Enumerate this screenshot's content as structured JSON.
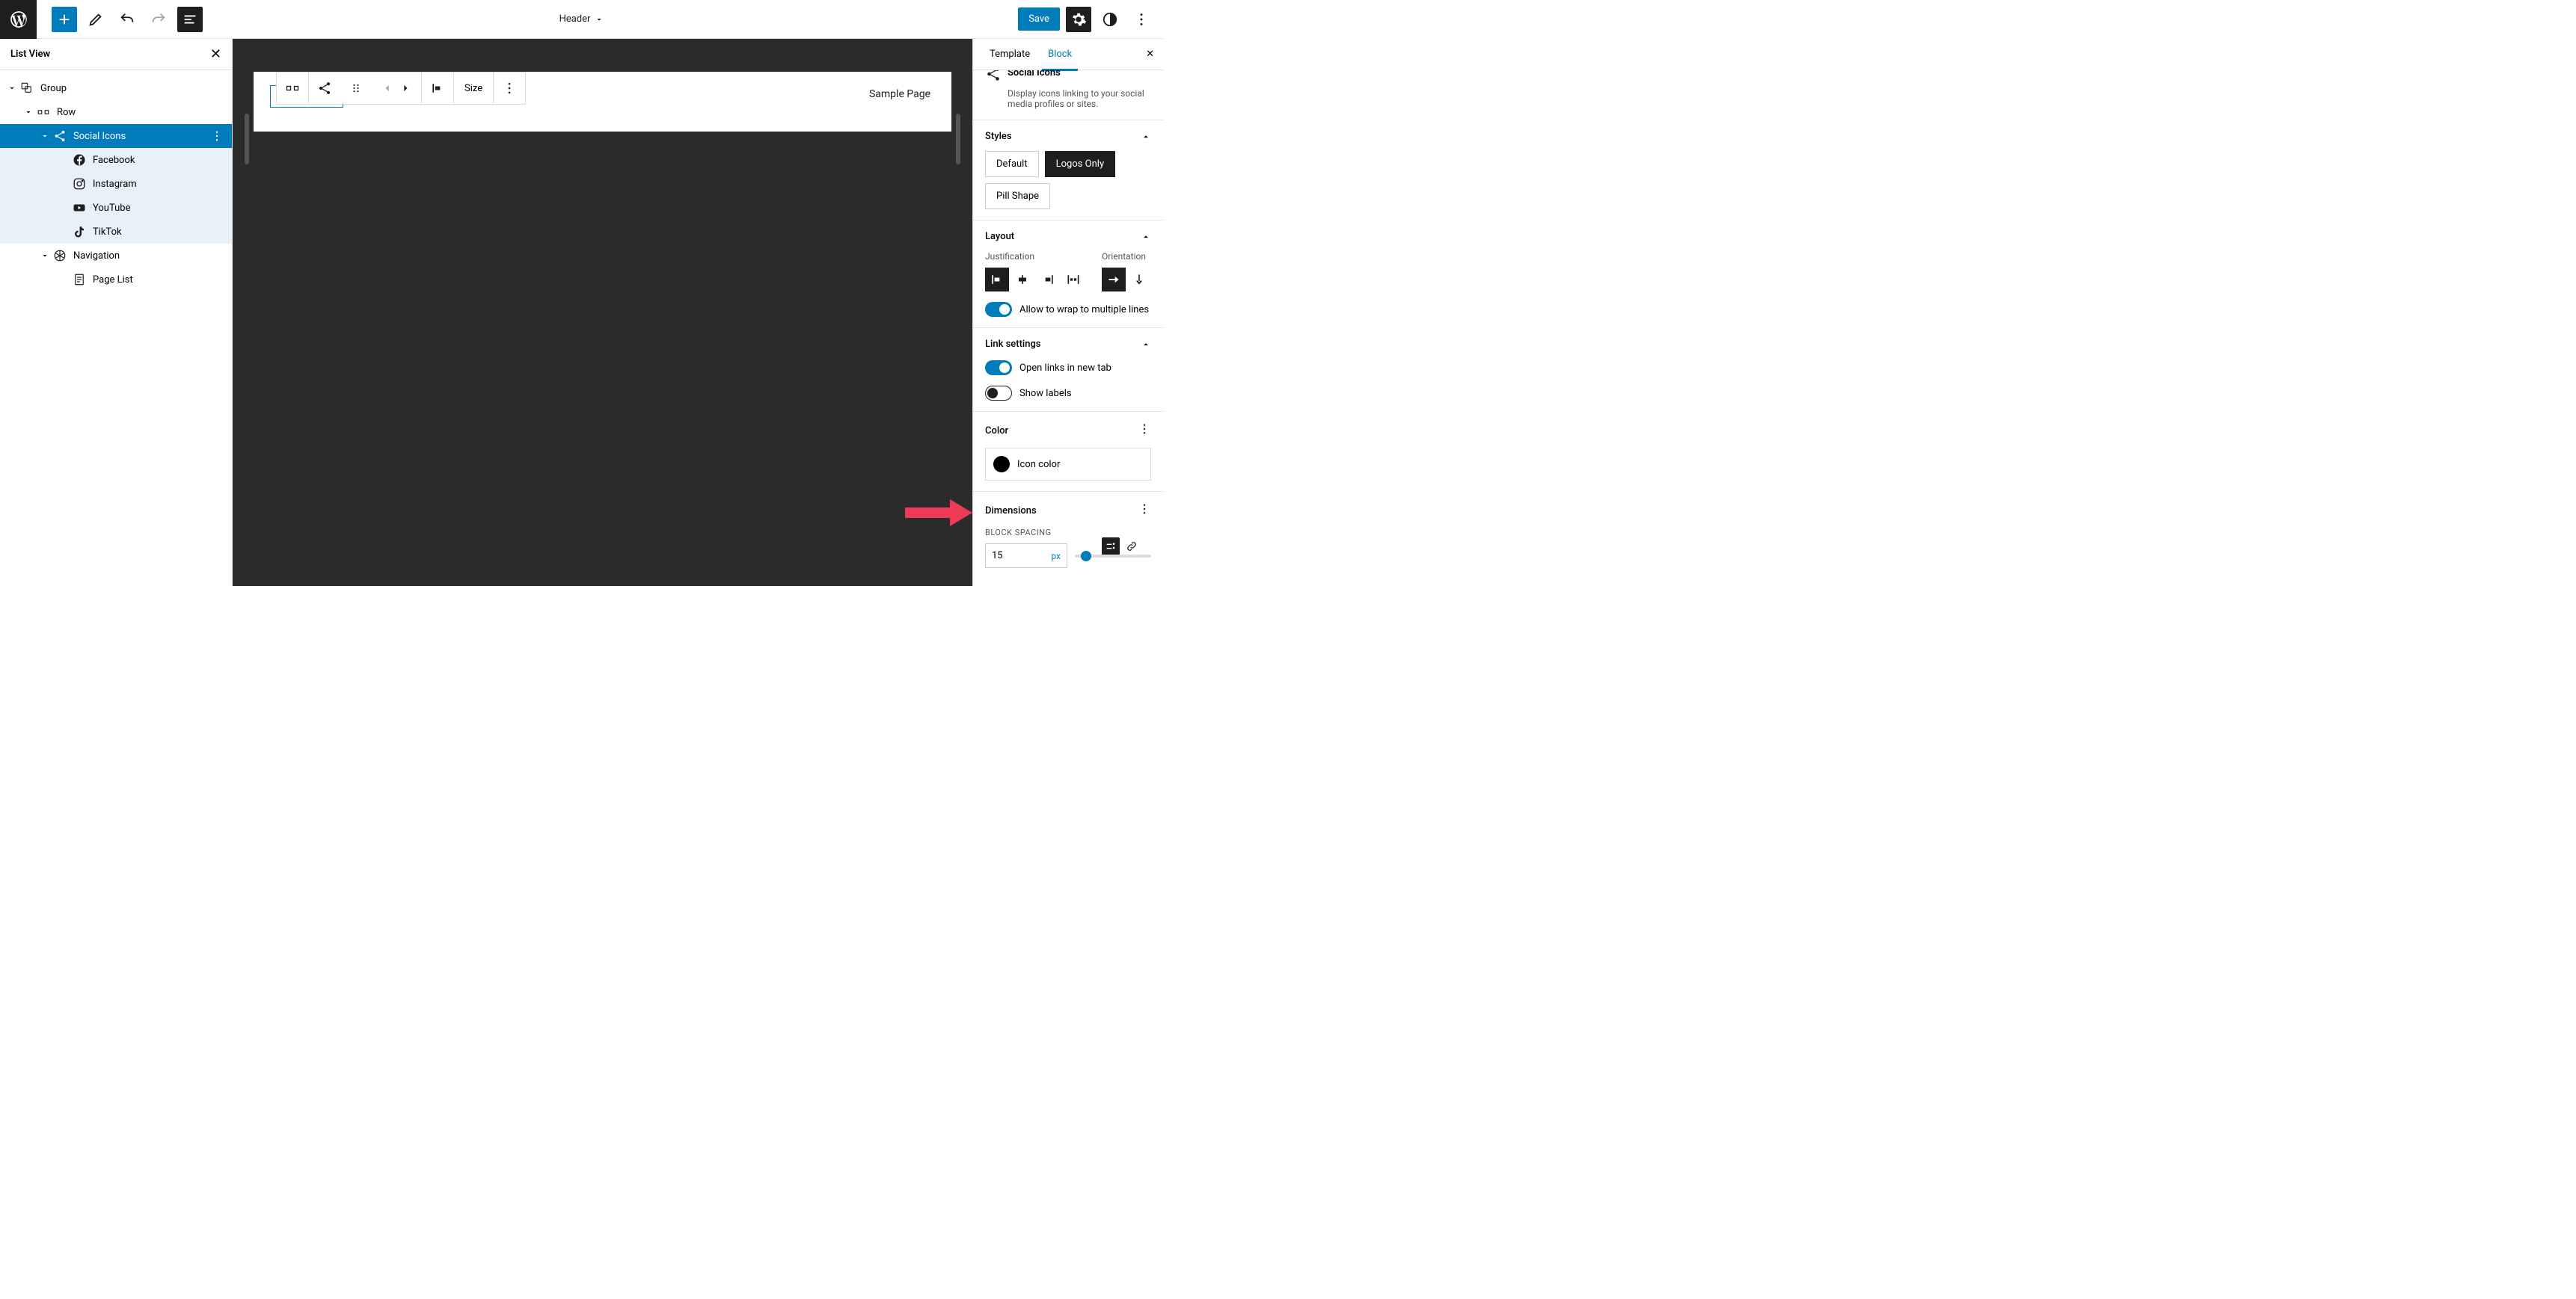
{
  "toolbar": {
    "document_title": "Header",
    "save_label": "Save"
  },
  "list_view": {
    "title": "List View",
    "items": [
      {
        "label": "Group"
      },
      {
        "label": "Row"
      },
      {
        "label": "Social Icons"
      },
      {
        "label": "Facebook"
      },
      {
        "label": "Instagram"
      },
      {
        "label": "YouTube"
      },
      {
        "label": "TikTok"
      },
      {
        "label": "Navigation"
      },
      {
        "label": "Page List"
      }
    ]
  },
  "canvas": {
    "floating_toolbar": {
      "size_label": "Size"
    },
    "sample_link": "Sample Page"
  },
  "settings": {
    "tabs": {
      "template": "Template",
      "block": "Block"
    },
    "block_info": {
      "title": "Social Icons",
      "description": "Display icons linking to your social media profiles or sites."
    },
    "styles": {
      "label": "Styles",
      "options": [
        "Default",
        "Logos Only",
        "Pill Shape"
      ],
      "active": "Logos Only"
    },
    "layout": {
      "label": "Layout",
      "justification_label": "Justification",
      "orientation_label": "Orientation",
      "wrap_label": "Allow to wrap to multiple lines"
    },
    "link_settings": {
      "label": "Link settings",
      "open_new_tab": "Open links in new tab",
      "show_labels": "Show labels"
    },
    "color": {
      "label": "Color",
      "icon_color_label": "Icon color"
    },
    "dimensions": {
      "label": "Dimensions",
      "block_spacing_label": "Block Spacing",
      "value": "15",
      "unit": "px"
    }
  }
}
